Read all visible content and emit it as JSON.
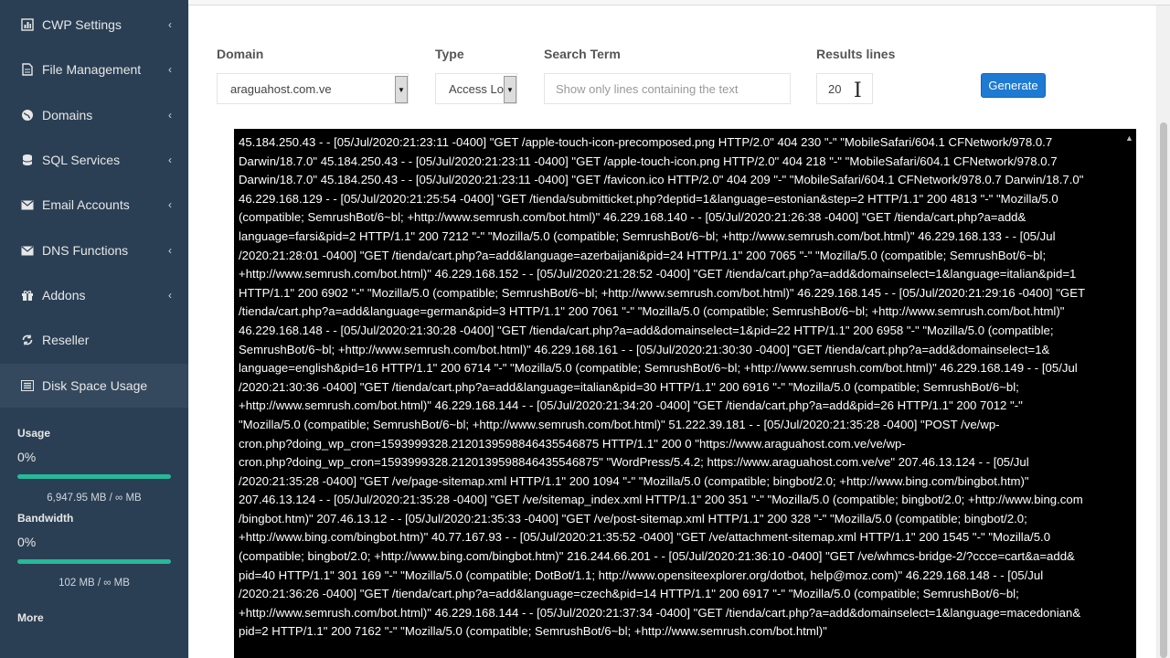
{
  "sidebar": {
    "items": [
      {
        "label": "CWP Settings",
        "icon": "chart-icon",
        "has_submenu": true
      },
      {
        "label": "File Management",
        "icon": "file-icon",
        "has_submenu": true
      },
      {
        "label": "Domains",
        "icon": "globe-icon",
        "has_submenu": true
      },
      {
        "label": "SQL Services",
        "icon": "database-icon",
        "has_submenu": true
      },
      {
        "label": "Email Accounts",
        "icon": "envelope-icon",
        "has_submenu": true
      },
      {
        "label": "DNS Functions",
        "icon": "envelope-icon",
        "has_submenu": true
      },
      {
        "label": "Addons",
        "icon": "gift-icon",
        "has_submenu": true
      },
      {
        "label": "Reseller",
        "icon": "refresh-icon",
        "has_submenu": false
      },
      {
        "label": "Disk Space Usage",
        "icon": "list-icon",
        "has_submenu": false
      }
    ],
    "usage": {
      "title": "Usage",
      "percent": "0%",
      "fraction": 1.0,
      "amount": "6,947.95 MB / ∞ MB"
    },
    "bandwidth": {
      "title": "Bandwidth",
      "percent": "0%",
      "fraction": 1.0,
      "amount": "102 MB / ∞ MB"
    },
    "more": "More",
    "chevron": "‹"
  },
  "filters": {
    "domain_label": "Domain",
    "domain_value": "araguahost.com.ve",
    "type_label": "Type",
    "type_value": "Access Log",
    "search_label": "Search Term",
    "search_placeholder": "Show only lines containing the text",
    "results_label": "Results lines",
    "results_value": "20",
    "generate_label": "Generate"
  },
  "log": {
    "lines": [
      "45.184.250.43 - - [05/Jul/2020:21:23:11 -0400] \"GET /apple-touch-icon-precomposed.png HTTP/2.0\" 404 230 \"-\" \"MobileSafari/604.1 CFNetwork/978.0.7",
      "Darwin/18.7.0\" 45.184.250.43 - - [05/Jul/2020:21:23:11 -0400] \"GET /apple-touch-icon.png HTTP/2.0\" 404 218 \"-\" \"MobileSafari/604.1 CFNetwork/978.0.7",
      "Darwin/18.7.0\" 45.184.250.43 - - [05/Jul/2020:21:23:11 -0400] \"GET /favicon.ico HTTP/2.0\" 404 209 \"-\" \"MobileSafari/604.1 CFNetwork/978.0.7 Darwin/18.7.0\"",
      "46.229.168.129 - - [05/Jul/2020:21:25:54 -0400] \"GET /tienda/submitticket.php?deptid=1&language=estonian&step=2 HTTP/1.1\" 200 4813 \"-\" \"Mozilla/5.0",
      "(compatible; SemrushBot/6~bl; +http://www.semrush.com/bot.html)\" 46.229.168.140 - - [05/Jul/2020:21:26:38 -0400] \"GET /tienda/cart.php?a=add&",
      "language=farsi&pid=2 HTTP/1.1\" 200 7212 \"-\" \"Mozilla/5.0 (compatible; SemrushBot/6~bl; +http://www.semrush.com/bot.html)\" 46.229.168.133 - - [05/Jul",
      "/2020:21:28:01 -0400] \"GET /tienda/cart.php?a=add&language=azerbaijani&pid=24 HTTP/1.1\" 200 7065 \"-\" \"Mozilla/5.0 (compatible; SemrushBot/6~bl;",
      "+http://www.semrush.com/bot.html)\" 46.229.168.152 - - [05/Jul/2020:21:28:52 -0400] \"GET /tienda/cart.php?a=add&domainselect=1&language=italian&pid=1",
      "HTTP/1.1\" 200 6902 \"-\" \"Mozilla/5.0 (compatible; SemrushBot/6~bl; +http://www.semrush.com/bot.html)\" 46.229.168.145 - - [05/Jul/2020:21:29:16 -0400] \"GET",
      "/tienda/cart.php?a=add&language=german&pid=3 HTTP/1.1\" 200 7061 \"-\" \"Mozilla/5.0 (compatible; SemrushBot/6~bl; +http://www.semrush.com/bot.html)\"",
      "46.229.168.148 - - [05/Jul/2020:21:30:28 -0400] \"GET /tienda/cart.php?a=add&domainselect=1&pid=22 HTTP/1.1\" 200 6958 \"-\" \"Mozilla/5.0 (compatible;",
      "SemrushBot/6~bl; +http://www.semrush.com/bot.html)\" 46.229.168.161 - - [05/Jul/2020:21:30:30 -0400] \"GET /tienda/cart.php?a=add&domainselect=1&",
      "language=english&pid=16 HTTP/1.1\" 200 6714 \"-\" \"Mozilla/5.0 (compatible; SemrushBot/6~bl; +http://www.semrush.com/bot.html)\" 46.229.168.149 - - [05/Jul",
      "/2020:21:30:36 -0400] \"GET /tienda/cart.php?a=add&language=italian&pid=30 HTTP/1.1\" 200 6916 \"-\" \"Mozilla/5.0 (compatible; SemrushBot/6~bl;",
      "+http://www.semrush.com/bot.html)\" 46.229.168.144 - - [05/Jul/2020:21:34:20 -0400] \"GET /tienda/cart.php?a=add&pid=26 HTTP/1.1\" 200 7012 \"-\"",
      "\"Mozilla/5.0 (compatible; SemrushBot/6~bl; +http://www.semrush.com/bot.html)\" 51.222.39.181 - - [05/Jul/2020:21:35:28 -0400] \"POST /ve/wp-",
      "cron.php?doing_wp_cron=1593999328.2120139598846435546875 HTTP/1.1\" 200 0 \"https://www.araguahost.com.ve/ve/wp-",
      "cron.php?doing_wp_cron=1593999328.2120139598846435546875\" \"WordPress/5.4.2; https://www.araguahost.com.ve/ve\" 207.46.13.124 - - [05/Jul",
      "/2020:21:35:28 -0400] \"GET /ve/page-sitemap.xml HTTP/1.1\" 200 1094 \"-\" \"Mozilla/5.0 (compatible; bingbot/2.0; +http://www.bing.com/bingbot.htm)\"",
      "207.46.13.124 - - [05/Jul/2020:21:35:28 -0400] \"GET /ve/sitemap_index.xml HTTP/1.1\" 200 351 \"-\" \"Mozilla/5.0 (compatible; bingbot/2.0; +http://www.bing.com",
      "/bingbot.htm)\" 207.46.13.12 - - [05/Jul/2020:21:35:33 -0400] \"GET /ve/post-sitemap.xml HTTP/1.1\" 200 328 \"-\" \"Mozilla/5.0 (compatible; bingbot/2.0;",
      "+http://www.bing.com/bingbot.htm)\" 40.77.167.93 - - [05/Jul/2020:21:35:52 -0400] \"GET /ve/attachment-sitemap.xml HTTP/1.1\" 200 1545 \"-\" \"Mozilla/5.0",
      "(compatible; bingbot/2.0; +http://www.bing.com/bingbot.htm)\" 216.244.66.201 - - [05/Jul/2020:21:36:10 -0400] \"GET /ve/whmcs-bridge-2/?ccce=cart&a=add&",
      "pid=40 HTTP/1.1\" 301 169 \"-\" \"Mozilla/5.0 (compatible; DotBot/1.1; http://www.opensiteexplorer.org/dotbot, help@moz.com)\" 46.229.168.148 - - [05/Jul",
      "/2020:21:36:26 -0400] \"GET /tienda/cart.php?a=add&language=czech&pid=14 HTTP/1.1\" 200 6917 \"-\" \"Mozilla/5.0 (compatible; SemrushBot/6~bl;",
      "+http://www.semrush.com/bot.html)\" 46.229.168.144 - - [05/Jul/2020:21:37:34 -0400] \"GET /tienda/cart.php?a=add&domainselect=1&language=macedonian&",
      "pid=2 HTTP/1.1\" 200 7162 \"-\" \"Mozilla/5.0 (compatible; SemrushBot/6~bl; +http://www.semrush.com/bot.html)\""
    ]
  }
}
